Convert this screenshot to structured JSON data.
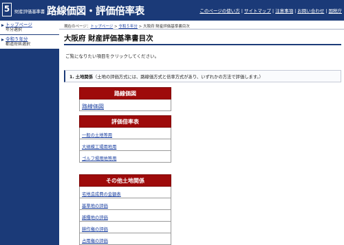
{
  "header": {
    "logo_number": "5",
    "logo_small": "財産評価基準書",
    "title": "路線価図・評価倍率表",
    "nav": [
      "このページの使い方",
      "サイトマップ",
      "注意事項",
      "お問い合わせ",
      "国税庁"
    ]
  },
  "sidebar": {
    "items": [
      {
        "label": "トップページ",
        "sub": "年分選択"
      },
      {
        "label": "令和５年分",
        "sub": "都道府県選択"
      }
    ]
  },
  "breadcrumb": {
    "prefix": "現在のページ：",
    "items": [
      "トップページ",
      "令和５年分"
    ],
    "current": "大阪府 財産評価基準書目次"
  },
  "main": {
    "title": "大阪府 財産評価基準書目次",
    "intro": "ご覧になりたい項目をクリックしてください。",
    "section": {
      "number": "1.",
      "heading": "土地関係",
      "note": "（土地の評価方式には、路線価方式と倍率方式があり、いずれかの方法で評価します。）"
    }
  },
  "tables": {
    "rosenka": {
      "header": "路線価図",
      "items": [
        "路線価図"
      ]
    },
    "bairitsu": {
      "header": "評価倍率表",
      "items": [
        "一般の土地等用",
        "大規模工場用地用",
        "ゴルフ場用地等用"
      ]
    },
    "other": {
      "header": "その他土地関係",
      "items": [
        "宅地造成費の金額表",
        "基準地の評価",
        "雑種地の評価",
        "耕作権の評価",
        "占用権の評価"
      ]
    }
  }
}
